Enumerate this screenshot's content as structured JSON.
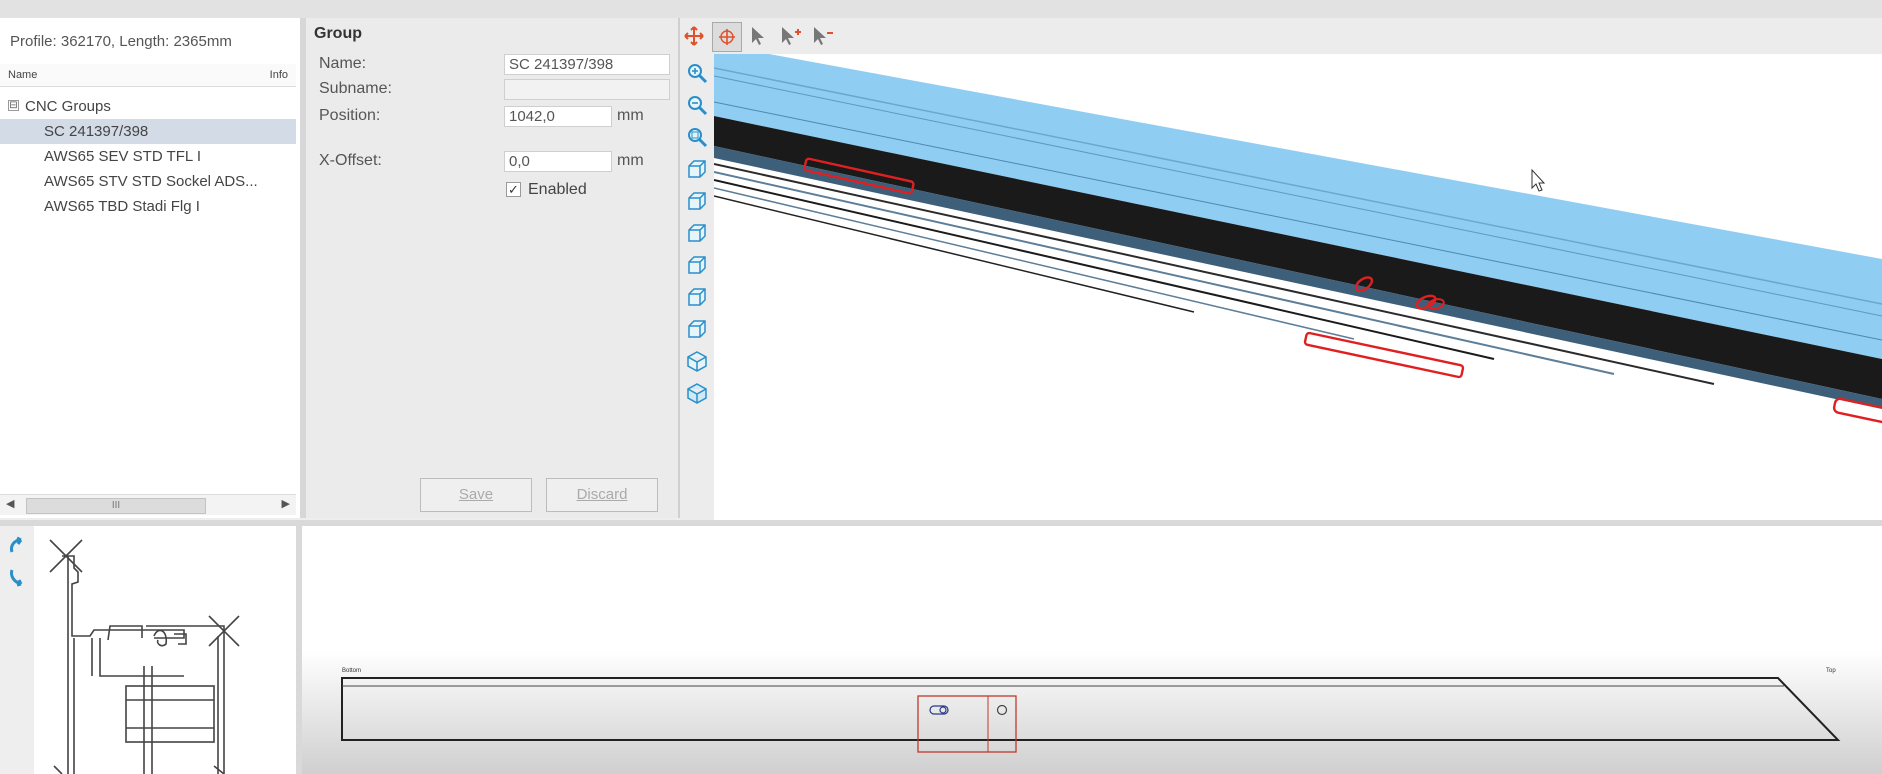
{
  "profile_info": "Profile: 362170, Length: 2365mm",
  "tree": {
    "header_name": "Name",
    "header_info": "Info",
    "root": {
      "expander": "⊟",
      "label": "CNC Groups"
    },
    "items": [
      {
        "label": "SC  241397/398",
        "selected": true
      },
      {
        "label": "AWS65 SEV STD TFL I",
        "selected": false
      },
      {
        "label": "AWS65 STV STD Sockel ADS...",
        "selected": false
      },
      {
        "label": "AWS65 TBD Stadi Flg I",
        "selected": false
      }
    ],
    "scroll_left": "◀",
    "scroll_right": "▶",
    "scroll_grip": "III"
  },
  "group": {
    "title": "Group",
    "name_label": "Name:",
    "name_value": "SC  241397/398",
    "subname_label": "Subname:",
    "subname_value": "",
    "position_label": "Position:",
    "position_value": "1042,0",
    "position_unit": "mm",
    "xoffset_label": "X-Offset:",
    "xoffset_value": "0,0",
    "xoffset_unit": "mm",
    "enabled_label": "Enabled",
    "enabled_check": "✓",
    "save_label": "Save",
    "discard_label": "Discard"
  },
  "side_view": {
    "left_tag": "Bottom",
    "right_tag": "Top"
  },
  "colors": {
    "profile_blue": "#8fcdf2",
    "profile_dark": "#1a1a1a",
    "machining_red": "#e02020",
    "accent_orange": "#e0502a",
    "icon_blue": "#2a8fc8"
  }
}
